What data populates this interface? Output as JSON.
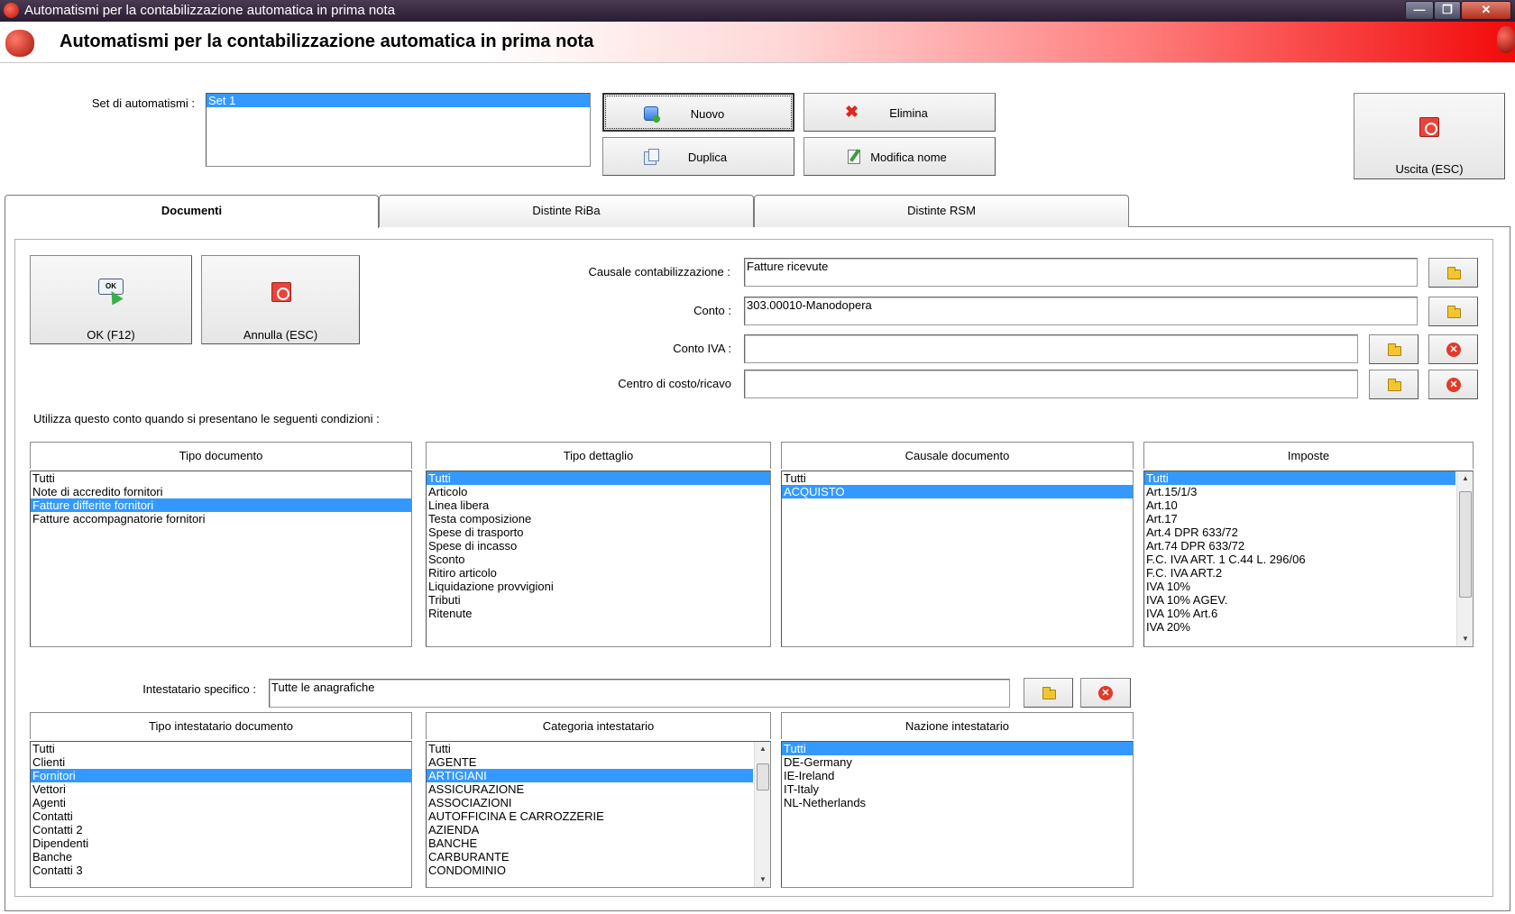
{
  "window": {
    "title": "Automatismi per la contabilizzazione automatica in prima nota",
    "minimize": "—",
    "maximize": "❐",
    "close": "✕"
  },
  "header": {
    "title": "Automatismi per la contabilizzazione automatica in prima nota"
  },
  "set": {
    "label": "Set di automatismi :",
    "items": [
      {
        "text": "Set 1",
        "selected": true
      }
    ]
  },
  "buttons": {
    "nuovo": "Nuovo",
    "elimina": "Elimina",
    "duplica": "Duplica",
    "modifica_nome": "Modifica nome",
    "uscita": "Uscita (ESC)"
  },
  "tabs": [
    "Documenti",
    "Distinte RiBa",
    "Distinte RSM"
  ],
  "actions": {
    "ok": "OK (F12)",
    "ok_icon_text": "OK",
    "annulla": "Annulla (ESC)"
  },
  "form": {
    "causale_label": "Causale contabilizzazione :",
    "causale_value": "Fatture ricevute",
    "conto_label": "Conto :",
    "conto_value": "303.00010-Manodopera",
    "conto_iva_label": "Conto IVA :",
    "conto_iva_value": "",
    "centro_label": "Centro di costo/ricavo",
    "centro_value": "",
    "condizioni_label": "Utilizza questo conto quando si presentano le seguenti condizioni :",
    "intestatario_label": "Intestatario specifico :",
    "intestatario_value": "Tutte le anagrafiche"
  },
  "lists": {
    "tipo_documento": {
      "header": "Tipo documento",
      "items": [
        {
          "text": "Tutti"
        },
        {
          "text": "Note di accredito fornitori"
        },
        {
          "text": "Fatture differite fornitori",
          "selected": true
        },
        {
          "text": "Fatture accompagnatorie fornitori"
        }
      ]
    },
    "tipo_dettaglio": {
      "header": "Tipo dettaglio",
      "items": [
        {
          "text": "Tutti",
          "selected": true
        },
        {
          "text": "Articolo"
        },
        {
          "text": "Linea libera"
        },
        {
          "text": "Testa composizione"
        },
        {
          "text": "Spese di trasporto"
        },
        {
          "text": "Spese di incasso"
        },
        {
          "text": "Sconto"
        },
        {
          "text": "Ritiro articolo"
        },
        {
          "text": "Liquidazione provvigioni"
        },
        {
          "text": "Tributi"
        },
        {
          "text": "Ritenute"
        }
      ]
    },
    "causale_documento": {
      "header": "Causale documento",
      "items": [
        {
          "text": "Tutti"
        },
        {
          "text": "ACQUISTO",
          "selected": true
        }
      ]
    },
    "imposte": {
      "header": "Imposte",
      "items": [
        {
          "text": "Tutti",
          "selected": true
        },
        {
          "text": "Art.15/1/3"
        },
        {
          "text": "Art.10"
        },
        {
          "text": "Art.17"
        },
        {
          "text": "Art.4 DPR 633/72"
        },
        {
          "text": "Art.74 DPR 633/72"
        },
        {
          "text": "F.C. IVA ART. 1 C.44 L. 296/06"
        },
        {
          "text": "F.C. IVA ART.2"
        },
        {
          "text": "IVA 10%"
        },
        {
          "text": "IVA 10% AGEV."
        },
        {
          "text": "IVA 10% Art.6"
        },
        {
          "text": "IVA 20%"
        }
      ]
    },
    "tipo_intestatario": {
      "header": "Tipo intestatario documento",
      "items": [
        {
          "text": "Tutti"
        },
        {
          "text": "Clienti"
        },
        {
          "text": "Fornitori",
          "selected": true
        },
        {
          "text": "Vettori"
        },
        {
          "text": "Agenti"
        },
        {
          "text": "Contatti"
        },
        {
          "text": "Contatti 2"
        },
        {
          "text": "Dipendenti"
        },
        {
          "text": "Banche"
        },
        {
          "text": "Contatti 3"
        }
      ]
    },
    "categoria_intestatario": {
      "header": "Categoria intestatario",
      "items": [
        {
          "text": "Tutti"
        },
        {
          "text": "AGENTE"
        },
        {
          "text": "ARTIGIANI",
          "selected": true
        },
        {
          "text": "ASSICURAZIONE"
        },
        {
          "text": "ASSOCIAZIONI"
        },
        {
          "text": "AUTOFFICINA E CARROZZERIE"
        },
        {
          "text": "AZIENDA"
        },
        {
          "text": "BANCHE"
        },
        {
          "text": "CARBURANTE"
        },
        {
          "text": "CONDOMINIO"
        }
      ]
    },
    "nazione_intestatario": {
      "header": "Nazione intestatario",
      "items": [
        {
          "text": "Tutti",
          "selected": true
        },
        {
          "text": "DE-Germany"
        },
        {
          "text": "IE-Ireland"
        },
        {
          "text": "IT-Italy"
        },
        {
          "text": "NL-Netherlands"
        }
      ]
    }
  },
  "colors": {
    "selection": "#3399ff",
    "header_gradient_end": "#f20a0a",
    "titlebar": "#2a1c33"
  }
}
